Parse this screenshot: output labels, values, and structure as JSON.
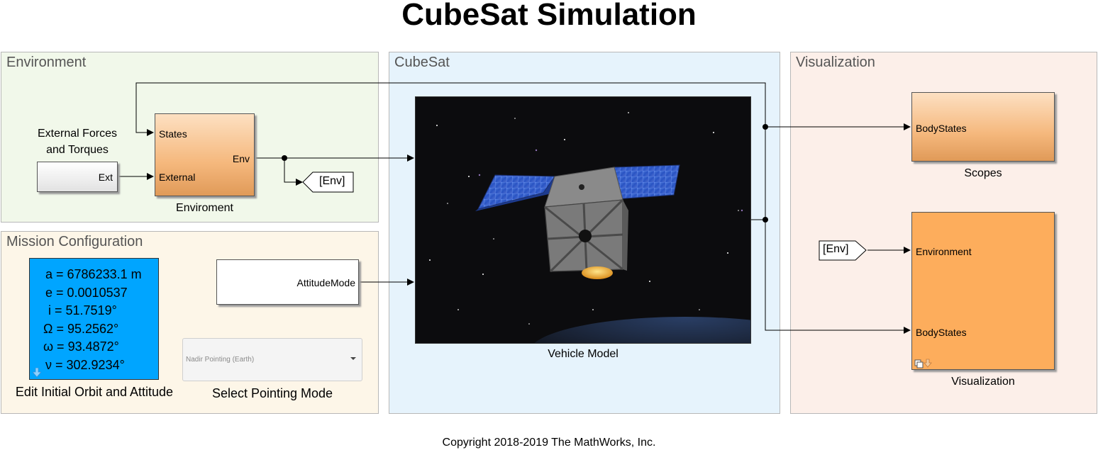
{
  "page_title": "CubeSat Simulation",
  "copyright": "Copyright 2018-2019 The MathWorks, Inc.",
  "areas": {
    "environment": "Environment",
    "mission": "Mission Configuration",
    "cubesat": "CubeSat",
    "visualization": "Visualization"
  },
  "environment": {
    "ext_caption": "External Forces\nand Torques",
    "ext_port": "Ext",
    "env_block": {
      "in1": "States",
      "in2": "External",
      "out": "Env",
      "name": "Enviroment"
    },
    "goto_tag": "[Env]"
  },
  "mission": {
    "orbit": {
      "a": "a = 6786233.1 m",
      "e": "e = 0.0010537",
      "i": "i = 51.7519°",
      "raan": "Ω = 95.2562°",
      "argp": "ω = 93.4872°",
      "nu": "ν = 302.9234°"
    },
    "orbit_caption": "Edit Initial Orbit and Attitude",
    "attitude_port": "AttitudeMode",
    "dropdown_value": "Nadir Pointing (Earth)",
    "dropdown_caption": "Select Pointing Mode"
  },
  "cubesat": {
    "vehicle_caption": "Vehicle Model"
  },
  "visualization": {
    "scopes_port": "BodyStates",
    "scopes_caption": "Scopes",
    "from_tag": "[Env]",
    "vis_port_env": "Environment",
    "vis_port_body": "BodyStates",
    "vis_caption": "Visualization"
  },
  "colors": {
    "env_area": "#f1f8ea",
    "mission_area": "#fdf6e8",
    "cubesat_area": "#e6f3fc",
    "vis_area": "#fcefe9",
    "orbit_block": "#00a5ff"
  }
}
